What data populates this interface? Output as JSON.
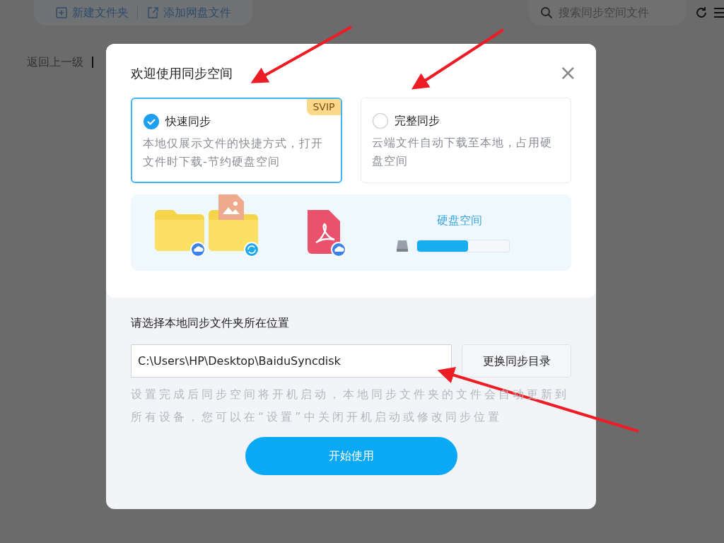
{
  "toolbar": {
    "buttons": [
      {
        "label": "新建文件夹",
        "kind": "new-folder"
      },
      {
        "label": "添加网盘文件",
        "kind": "add-file"
      }
    ],
    "search": {
      "placeholder": "搜索同步空间文件"
    }
  },
  "back_link": "返回上一级",
  "dialog": {
    "title": "欢迎使用同步空间",
    "close": "×",
    "options": [
      {
        "title": "快速同步",
        "description": "本地仅展示文件的快捷方式，打开文件时下载-节约硬盘空间",
        "selected": true,
        "badge": "SVIP"
      },
      {
        "title": "完整同步",
        "description": "云端文件自动下载至本地，占用硬盘空间",
        "selected": false
      }
    ],
    "disk": {
      "label": "硬盘空间",
      "level": 0.55
    },
    "location": {
      "label": "请选择本地同步文件夹所在位置",
      "path": "C:\\Users\\HP\\Desktop\\BaiduSyncdisk",
      "change_button": "更换同步目录",
      "note": "设置完成后同步空间将开机启动，本地同步文件夹的文件会自动更新到所有设备，您可以在“设置”中关闭开机启动或修改同步位置",
      "start_button": "开始使用"
    }
  }
}
